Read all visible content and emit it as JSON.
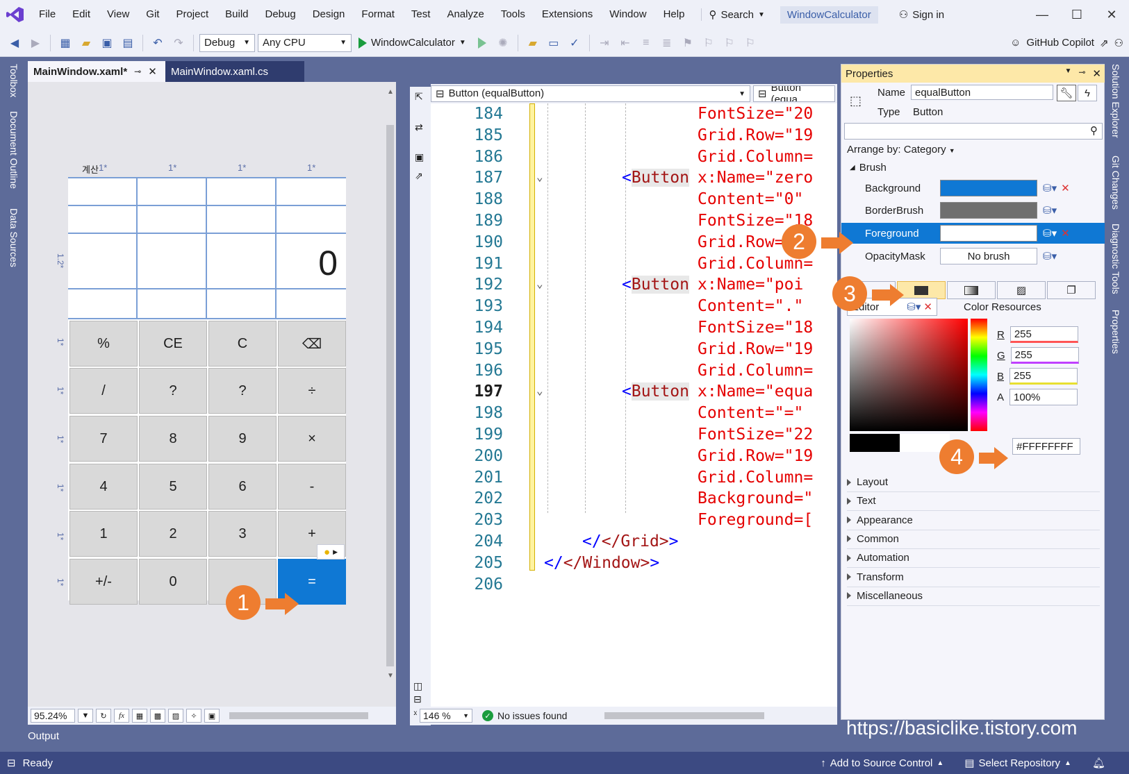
{
  "menubar": {
    "items": [
      "File",
      "Edit",
      "View",
      "Git",
      "Project",
      "Build",
      "Debug",
      "Design",
      "Format",
      "Test",
      "Analyze",
      "Tools",
      "Extensions",
      "Window",
      "Help"
    ],
    "search_label": "Search",
    "project_name": "WindowCalculator",
    "signin_label": "Sign in"
  },
  "toolbar": {
    "config": "Debug",
    "platform": "Any CPU",
    "run_target": "WindowCalculator",
    "copilot_label": "GitHub Copilot"
  },
  "left_tabs": [
    "Toolbox",
    "Document Outline",
    "Data Sources"
  ],
  "right_tabs": [
    "Solution Explorer",
    "Git Changes",
    "Diagnostic Tools",
    "Properties"
  ],
  "doc_tabs": [
    {
      "label": "MainWindow.xaml*",
      "active": true
    },
    {
      "label": "MainWindow.xaml.cs",
      "active": false
    }
  ],
  "designer": {
    "title_fragment": "계산",
    "col_sizes": [
      "1*",
      "1*",
      "1*",
      "1*"
    ],
    "row_sizes": [
      "1.2*",
      "1*",
      "1*",
      "1*",
      "1*",
      "1*",
      "1*"
    ],
    "display_value": "0",
    "buttons": [
      [
        "%",
        "CE",
        "C",
        "⌫"
      ],
      [
        "/",
        "?",
        "?",
        "÷"
      ],
      [
        "7",
        "8",
        "9",
        "×"
      ],
      [
        "4",
        "5",
        "6",
        "-"
      ],
      [
        "1",
        "2",
        "3",
        "+"
      ],
      [
        "+/-",
        "0",
        "",
        "="
      ]
    ],
    "zoom": "95.24%",
    "fx_label": "fx"
  },
  "editor": {
    "element_selector": "Button (equalButton)",
    "member_selector": "Button (equa",
    "zoom": "146 %",
    "status": "No issues found",
    "current_line": 197,
    "lines": [
      {
        "n": 184,
        "text": [
          {
            "t": "FontSize=\"20",
            "c": "attr"
          }
        ]
      },
      {
        "n": 185,
        "text": [
          {
            "t": "Grid.Row=\"19",
            "c": "attr"
          }
        ]
      },
      {
        "n": 186,
        "text": [
          {
            "t": "Grid.Column=",
            "c": "attr"
          }
        ]
      },
      {
        "n": 187,
        "tag": "Button",
        "text": [
          {
            "t": "x:Name=\"zero",
            "c": "attr"
          }
        ]
      },
      {
        "n": 188,
        "text": [
          {
            "t": "Content=\"0\"",
            "c": "attr"
          }
        ]
      },
      {
        "n": 189,
        "text": [
          {
            "t": "FontSize=\"18",
            "c": "attr"
          }
        ]
      },
      {
        "n": 190,
        "text": [
          {
            "t": "Grid.Row=\"19",
            "c": "attr"
          }
        ]
      },
      {
        "n": 191,
        "text": [
          {
            "t": "Grid.Column=",
            "c": "attr"
          }
        ]
      },
      {
        "n": 192,
        "tag": "Button",
        "text": [
          {
            "t": "x:Name=\"poi",
            "c": "attr"
          }
        ]
      },
      {
        "n": 193,
        "text": [
          {
            "t": "Content=\".\"",
            "c": "attr"
          }
        ]
      },
      {
        "n": 194,
        "text": [
          {
            "t": "FontSize=\"18",
            "c": "attr"
          }
        ]
      },
      {
        "n": 195,
        "text": [
          {
            "t": "Grid.Row=\"19",
            "c": "attr"
          }
        ]
      },
      {
        "n": 196,
        "text": [
          {
            "t": "Grid.Column=",
            "c": "attr"
          }
        ]
      },
      {
        "n": 197,
        "tag": "Button",
        "text": [
          {
            "t": "x:Name=\"equa",
            "c": "attr"
          }
        ]
      },
      {
        "n": 198,
        "text": [
          {
            "t": "Content=\"=\"",
            "c": "attr"
          }
        ]
      },
      {
        "n": 199,
        "text": [
          {
            "t": "FontSize=\"22",
            "c": "attr"
          }
        ]
      },
      {
        "n": 200,
        "text": [
          {
            "t": "Grid.Row=\"19",
            "c": "attr"
          }
        ]
      },
      {
        "n": 201,
        "text": [
          {
            "t": "Grid.Column=",
            "c": "attr"
          }
        ]
      },
      {
        "n": 202,
        "text": [
          {
            "t": "Background=\"",
            "c": "attr"
          }
        ]
      },
      {
        "n": 203,
        "text": [
          {
            "t": "Foreground=[",
            "c": "attr"
          }
        ]
      },
      {
        "n": 204,
        "close": "</Grid>"
      },
      {
        "n": 205,
        "close": "</Window>"
      },
      {
        "n": 206
      }
    ]
  },
  "properties": {
    "title": "Properties",
    "name_label": "Name",
    "name_value": "equalButton",
    "type_label": "Type",
    "type_value": "Button",
    "arrange_by": "Arrange by: Category",
    "brush_section": "Brush",
    "brush_rows": [
      {
        "label": "Background",
        "color": "#0f78d4"
      },
      {
        "label": "BorderBrush",
        "color": "#6f6f6f"
      },
      {
        "label": "Foreground",
        "color": "#ffffff"
      },
      {
        "label": "OpacityMask",
        "text": "No brush"
      }
    ],
    "editor_tab": "Editor",
    "color_resources_tab": "Color Resources",
    "rgba": [
      {
        "label": "R",
        "value": "255"
      },
      {
        "label": "G",
        "value": "255"
      },
      {
        "label": "B",
        "value": "255"
      },
      {
        "label": "A",
        "value": "100%"
      }
    ],
    "hex_value": "#FFFFFFFF",
    "sections": [
      "Layout",
      "Text",
      "Appearance",
      "Common",
      "Automation",
      "Transform",
      "Miscellaneous"
    ]
  },
  "annotations": [
    "1",
    "2",
    "3",
    "4"
  ],
  "output_tab": "Output",
  "watermark": "https://basiclike.tistory.com",
  "statusbar": {
    "ready": "Ready",
    "add_to_source": "Add to Source Control",
    "select_repo": "Select Repository"
  }
}
